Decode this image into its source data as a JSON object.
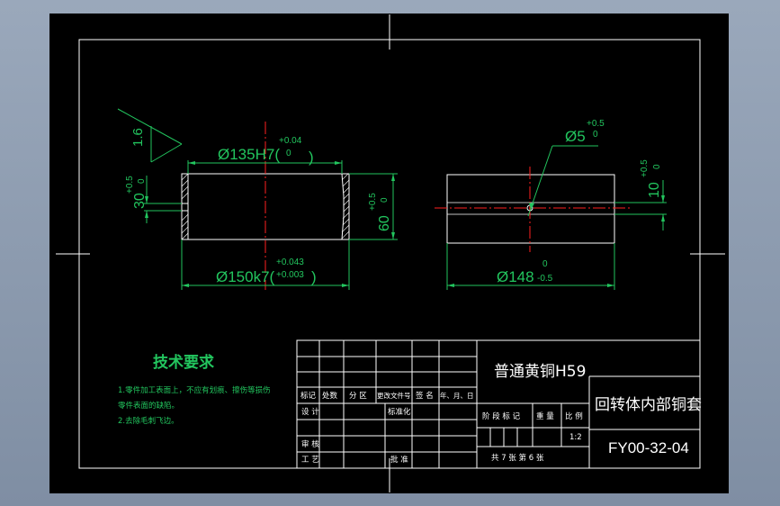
{
  "colors": {
    "background": "#000000",
    "frame": "#ffffff",
    "dimension": "#22c55e",
    "centerline": "#ff2020",
    "hatch": "#ffffff",
    "text_white": "#ffffff",
    "text_green": "#22c55e"
  },
  "drawing": {
    "left_view": {
      "dim_top_main": "Ø135H7(",
      "dim_top_upper": "+0.04",
      "dim_top_lower": "0",
      "dim_top_close": ")",
      "dim_bottom_main": "Ø150k7(",
      "dim_bottom_upper": "+0.043",
      "dim_bottom_lower": "+0.003",
      "dim_bottom_close": ")",
      "dim_right_main": "60",
      "dim_right_upper": "+0.5",
      "dim_right_lower": "0",
      "dim_left_main": "30",
      "dim_left_upper": "+0.5",
      "dim_left_lower": "0",
      "roughness": "1.6"
    },
    "right_view": {
      "angle_main": "Ø5",
      "angle_upper": "+0.5",
      "angle_lower": "0",
      "dim_right_main": "10",
      "dim_right_upper": "+0.5",
      "dim_right_lower": "0",
      "dim_bottom_main": "Ø148",
      "dim_bottom_upper": "0",
      "dim_bottom_lower": "-0.5"
    }
  },
  "tech_requirements": {
    "title": "技术要求",
    "item1_line1": "1.零件加工表面上，不应有划痕、擦伤等损伤",
    "item1_line2": "零件表面的缺陷。",
    "item2": "2.去除毛刺飞边。"
  },
  "title_block": {
    "material": "普通黄铜H59",
    "part_name": "回转体内部铜套",
    "drawing_no": "FY00-32-04",
    "labels": {
      "mark": "标记",
      "count": "处数",
      "zone": "分 区",
      "change_doc": "更改文件号",
      "sign": "签 名",
      "date": "年、月、日",
      "design": "设 计",
      "standardize": "标准化",
      "review": "审 核",
      "process": "工 艺",
      "approve": "批 准",
      "stage_mark": "阶 段 标 记",
      "weight": "重 量",
      "scale": "比 例"
    },
    "scale_value": "1:2",
    "sheet_info": "共 7  张  第  6 张"
  }
}
